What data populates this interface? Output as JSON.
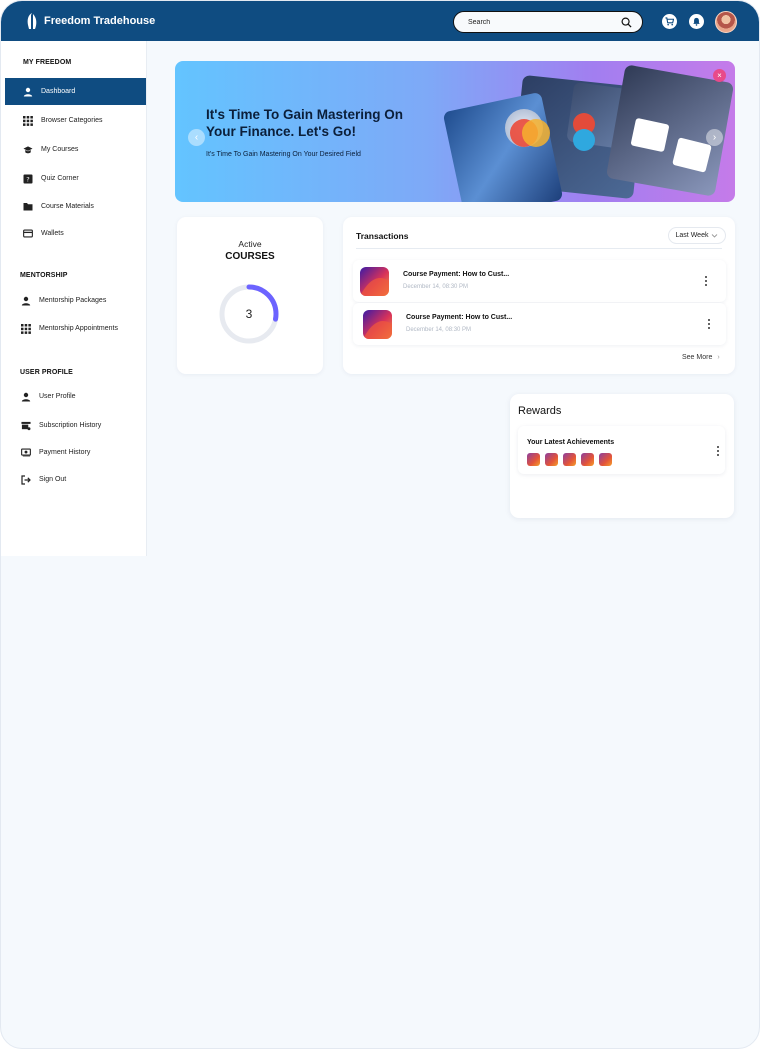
{
  "brand": {
    "name": "Freedom Tradehouse"
  },
  "search": {
    "placeholder": "Search"
  },
  "sidebar": {
    "sections": [
      {
        "title": "MY FREEDOM"
      },
      {
        "title": "MENTORSHIP"
      },
      {
        "title": "USER PROFILE"
      }
    ],
    "items": [
      {
        "label": "Dashboard",
        "icon": "user-icon"
      },
      {
        "label": "Browser Categories",
        "icon": "grid-icon"
      },
      {
        "label": "My Courses",
        "icon": "graduation-cap-icon"
      },
      {
        "label": "Quiz Corner",
        "icon": "quiz-icon"
      },
      {
        "label": "Course Materials",
        "icon": "folder-icon"
      },
      {
        "label": "Wallets",
        "icon": "wallet-icon"
      },
      {
        "label": "Mentorship Packages",
        "icon": "user-icon"
      },
      {
        "label": "Mentorship Appointments",
        "icon": "grid-icon"
      },
      {
        "label": "User Profile",
        "icon": "user-icon"
      },
      {
        "label": "Subscription History",
        "icon": "store-icon"
      },
      {
        "label": "Payment History",
        "icon": "cash-icon"
      },
      {
        "label": "Sign Out",
        "icon": "sign-out-icon"
      }
    ]
  },
  "banner": {
    "title": "It's Time To Gain Mastering On Your Finance. Let's Go!",
    "subtitle": "It's Time To Gain Mastering On Your Desired Field"
  },
  "courses": {
    "label": "Active",
    "title": "COURSES",
    "count": "3",
    "progress": 0.28
  },
  "transactions": {
    "title": "Transactions",
    "filter": "Last Week",
    "items": [
      {
        "name": "Course Payment: How to Cust...",
        "date": "December 14, 08:30 PM"
      },
      {
        "name": "Course Payment: How to Cust...",
        "date": "December 14, 08:30 PM"
      }
    ],
    "see_more": "See More"
  },
  "rewards": {
    "title": "Rewards",
    "subtitle": "Your Latest Achievements",
    "badge_count": 5
  },
  "colors": {
    "primary": "#0f4c81",
    "accent": "#6c63ff",
    "close": "#e84a8a"
  }
}
